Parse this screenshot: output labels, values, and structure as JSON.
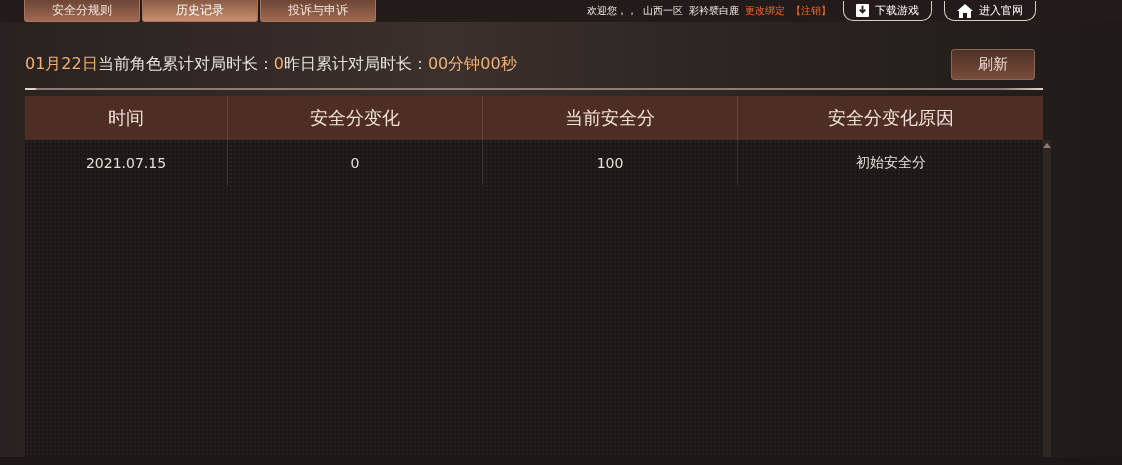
{
  "tabs": [
    {
      "label": "安全分规则",
      "selected": false
    },
    {
      "label": "历史记录",
      "selected": true
    },
    {
      "label": "投诉与申诉",
      "selected": false
    }
  ],
  "user_bar": {
    "greeting": "欢迎您，，",
    "server": "山西一区",
    "role": "彩衿襞白鹿",
    "rebind_link": "更改绑定",
    "logout_link": "【注销】"
  },
  "header_buttons": [
    {
      "kind": "download",
      "label": "下载游戏"
    },
    {
      "kind": "home",
      "label": "进入官网"
    }
  ],
  "summary": {
    "date": "01月22日",
    "current_label": "当前角色累计对局时长：",
    "current_value": "0",
    "yesterday_label": "昨日累计对局时长：",
    "yesterday_value": "00分钟00秒"
  },
  "refresh_button": "刷新",
  "table": {
    "columns": [
      "时间",
      "安全分变化",
      "当前安全分",
      "安全分变化原因"
    ],
    "rows": [
      [
        "2021.07.15",
        "0",
        "100",
        "初始安全分"
      ]
    ]
  }
}
